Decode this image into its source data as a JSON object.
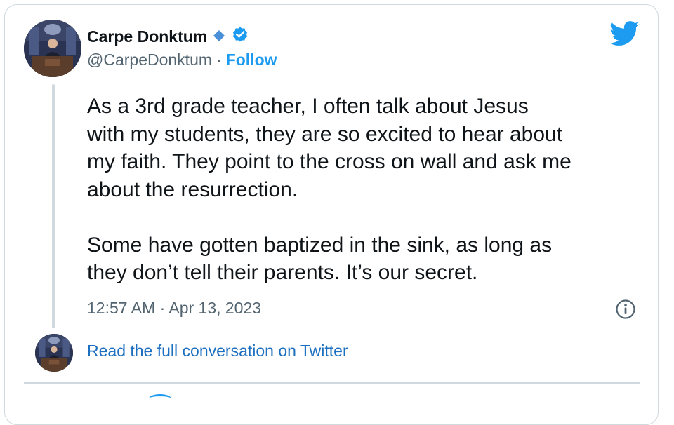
{
  "author": {
    "display_name": "Carpe Donktum",
    "handle": "@CarpeDonktum",
    "separator": "·",
    "follow_label": "Follow",
    "diamond_badge": "diamond-badge-icon",
    "verified_badge": "verified-badge-icon"
  },
  "tweet": {
    "text": "As a 3rd grade teacher, I often talk about Jesus\nwith my students, they are so excited to hear about\nmy faith. They point to the cross on wall and ask me\nabout the resurrection.\n\nSome have gotten baptized in the sink, as long as\nthey don’t tell their parents. It’s our secret.",
    "timestamp": "12:57 AM · Apr 13, 2023"
  },
  "footer": {
    "read_full_label": "Read the full conversation on Twitter"
  },
  "colors": {
    "accent": "#1d9bf0",
    "link": "#1d6fbf",
    "muted": "#536471",
    "border": "#cfd9de"
  }
}
